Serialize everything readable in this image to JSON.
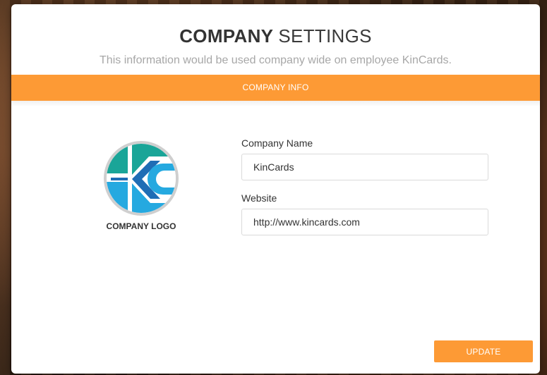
{
  "modal": {
    "title_bold": "COMPANY",
    "title_light": "SETTINGS",
    "subtitle": "This information would be used company wide on employee KinCards."
  },
  "section": {
    "label": "COMPANY INFO"
  },
  "logo": {
    "label": "COMPANY LOGO",
    "icon": "kincards-logo-icon"
  },
  "form": {
    "company_name": {
      "label": "Company Name",
      "value": "KinCards"
    },
    "website": {
      "label": "Website",
      "value": "http://www.kincards.com"
    }
  },
  "actions": {
    "update_label": "UPDATE"
  },
  "colors": {
    "accent": "#fd9a35",
    "logo_teal": "#1aa598",
    "logo_blue": "#1f6db5",
    "logo_light_blue": "#25a9e0"
  }
}
